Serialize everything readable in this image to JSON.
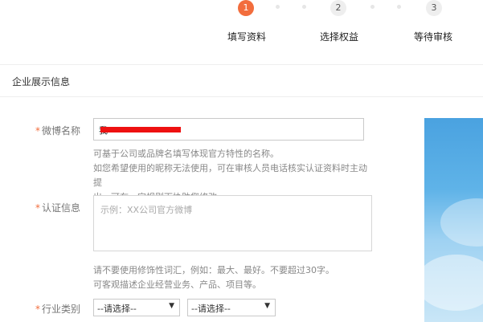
{
  "stepper": {
    "steps": [
      {
        "number": "1",
        "label": "填写资料"
      },
      {
        "number": "2",
        "label": "选择权益"
      },
      {
        "number": "3",
        "label": "等待审核"
      }
    ]
  },
  "section": {
    "title": "企业展示信息"
  },
  "form": {
    "weibo_name": {
      "label": "微博名称",
      "value": "我",
      "hint_lines": [
        "可基于公司或品牌名填写体现官方特性的名称。",
        "如您希望使用的昵称无法使用，可在审核人员电话核实认证资料时主动提",
        "出。可在一定规则下协助您修改。"
      ]
    },
    "verify_info": {
      "label": "认证信息",
      "placeholder": "示例：XX公司官方微博",
      "hint_lines": [
        "请不要使用修饰性词汇，例如：最大、最好。不要超过30字。",
        "可客观描述企业经营业务、产品、项目等。"
      ]
    },
    "industry": {
      "label": "行业类别",
      "select1": "--请选择--",
      "select2": "--请选择--"
    }
  }
}
